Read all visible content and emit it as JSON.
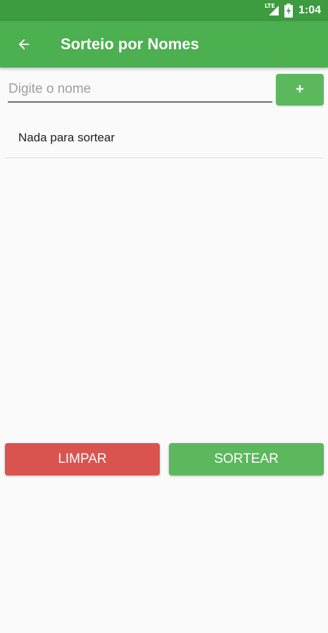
{
  "status_bar": {
    "network_label": "LTE",
    "network_icon": "signal-icon",
    "battery_icon": "battery-charging-icon",
    "time": "1:04"
  },
  "app_bar": {
    "back_icon": "arrow-left-icon",
    "title": "Sorteio por Nomes"
  },
  "input": {
    "value": "",
    "placeholder": "Digite o nome"
  },
  "add_button": {
    "label": "+"
  },
  "list": {
    "empty_text": "Nada para sortear"
  },
  "actions": {
    "clear_label": "LIMPAR",
    "draw_label": "SORTEAR"
  },
  "colors": {
    "status_bar": "#3d9b40",
    "app_bar": "#4caf50",
    "primary_button": "#5cb85c",
    "danger_button": "#d9534f",
    "background": "#fafafa"
  }
}
